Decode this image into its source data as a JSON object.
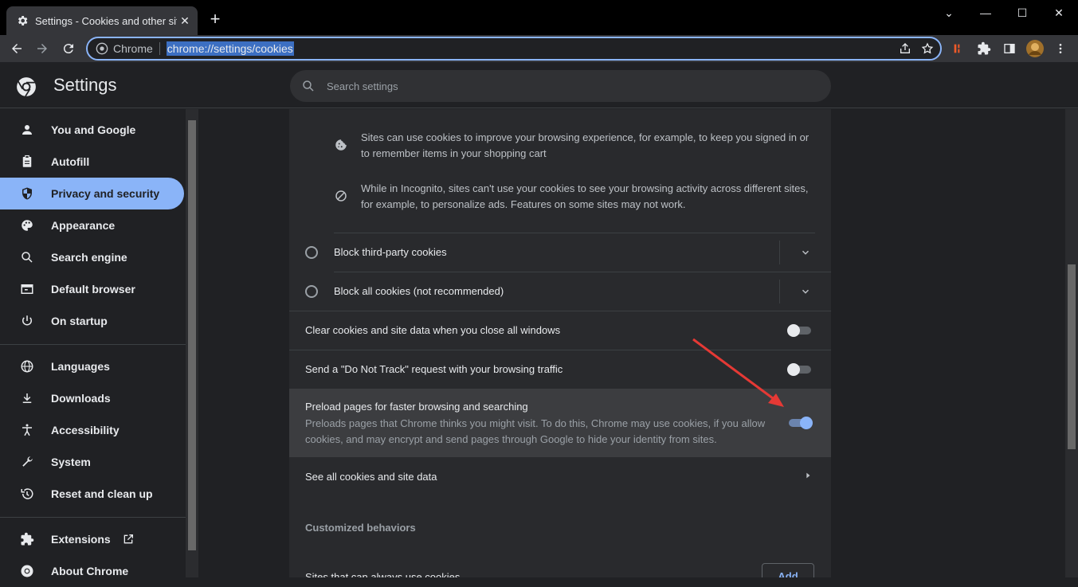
{
  "browser": {
    "tab_title": "Settings - Cookies and other site",
    "tab_close": "✕",
    "new_tab": "+",
    "window_controls": [
      "⌄",
      "—",
      "☐",
      "✕"
    ],
    "omnibox_site": "Chrome",
    "omnibox_url": "chrome://settings/cookies"
  },
  "app": {
    "title": "Settings",
    "search_placeholder": "Search settings"
  },
  "sidebar": {
    "items": [
      {
        "label": "You and Google",
        "icon": "person-icon"
      },
      {
        "label": "Autofill",
        "icon": "clipboard-icon"
      },
      {
        "label": "Privacy and security",
        "icon": "shield-icon",
        "active": true
      },
      {
        "label": "Appearance",
        "icon": "palette-icon"
      },
      {
        "label": "Search engine",
        "icon": "search-icon"
      },
      {
        "label": "Default browser",
        "icon": "browser-icon"
      },
      {
        "label": "On startup",
        "icon": "power-icon"
      },
      {
        "label": "Languages",
        "icon": "globe-icon"
      },
      {
        "label": "Downloads",
        "icon": "download-icon"
      },
      {
        "label": "Accessibility",
        "icon": "accessibility-icon"
      },
      {
        "label": "System",
        "icon": "wrench-icon"
      },
      {
        "label": "Reset and clean up",
        "icon": "restore-icon"
      },
      {
        "label": "Extensions",
        "icon": "puzzle-icon"
      },
      {
        "label": "About Chrome",
        "icon": "chrome-icon"
      }
    ]
  },
  "main": {
    "info1": "Sites can use cookies to improve your browsing experience, for example, to keep you signed in or to remember items in your shopping cart",
    "info2": "While in Incognito, sites can't use your cookies to see your browsing activity across different sites, for example, to personalize ads. Features on some sites may not work.",
    "radio_block_third": "Block third-party cookies",
    "radio_block_all": "Block all cookies (not recommended)",
    "clear_on_close": {
      "label": "Clear cookies and site data when you close all windows",
      "on": false
    },
    "do_not_track": {
      "label": "Send a \"Do Not Track\" request with your browsing traffic",
      "on": false
    },
    "preload": {
      "label": "Preload pages for faster browsing and searching",
      "description": "Preloads pages that Chrome thinks you might visit. To do this, Chrome may use cookies, if you allow cookies, and may encrypt and send pages through Google to hide your identity from sites.",
      "on": true
    },
    "see_all": "See all cookies and site data",
    "customized_header": "Customized behaviors",
    "always_use": "Sites that can always use cookies",
    "add_label": "Add"
  },
  "colors": {
    "accent": "#8ab4f8",
    "annotation_arrow": "#e53935"
  }
}
